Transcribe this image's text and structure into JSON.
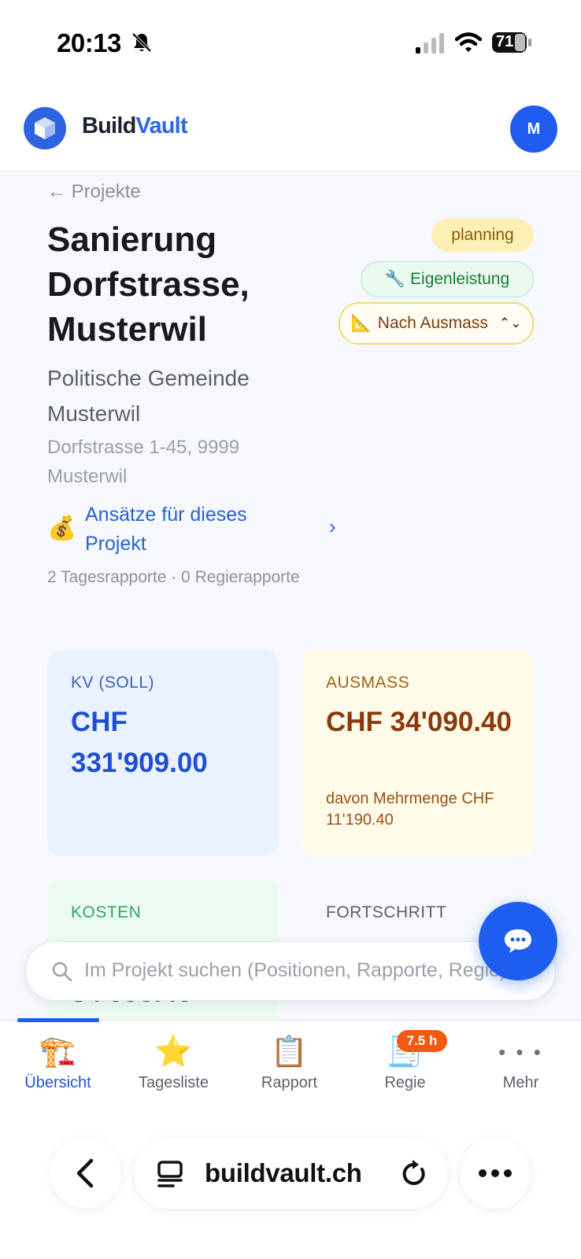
{
  "status": {
    "time": "20:13",
    "battery": "71"
  },
  "header": {
    "brand_part1": "Build",
    "brand_part2": "Vault",
    "avatar_initial": "M"
  },
  "project": {
    "back_label": "← Projekte",
    "title": "Sanierung Dorfstrasse, Musterwil",
    "client": "Politische Gemeinde Musterwil",
    "address": "Dorfstrasse 1-45, 9999 Musterwil",
    "status_badge": "planning",
    "type_badge": "Eigenleistung",
    "billing_select": "Nach Ausmass",
    "rates_link": "Ansätze für dieses Projekt",
    "counts": "2 Tagesrapporte · 0 Regierapporte"
  },
  "cards": {
    "kv": {
      "label": "KV (SOLL)",
      "value": "CHF 331'909.00"
    },
    "ausmass": {
      "label": "AUSMASS",
      "value": "CHF 34'090.40",
      "note": "davon Mehrmenge CHF 11'190.40"
    },
    "kosten": {
      "label": "KOSTEN",
      "value": "34'090.40"
    },
    "fortschritt": {
      "label": "FORTSCHRITT"
    }
  },
  "search": {
    "placeholder": "Im Projekt suchen (Positionen, Rapporte, Regie)"
  },
  "nav": {
    "items": [
      {
        "label": "Übersicht",
        "icon": "construction-crane-icon"
      },
      {
        "label": "Tagesliste",
        "icon": "star-icon"
      },
      {
        "label": "Rapport",
        "icon": "clipboard-icon"
      },
      {
        "label": "Regie",
        "icon": "receipt-icon"
      },
      {
        "label": "Mehr",
        "icon": "more-dots-icon"
      }
    ],
    "regie_badge": "7.5 h"
  },
  "browser": {
    "url": "buildvault.ch"
  },
  "colors": {
    "primary": "#1f5cf0",
    "badge_orange": "#f05a12"
  }
}
